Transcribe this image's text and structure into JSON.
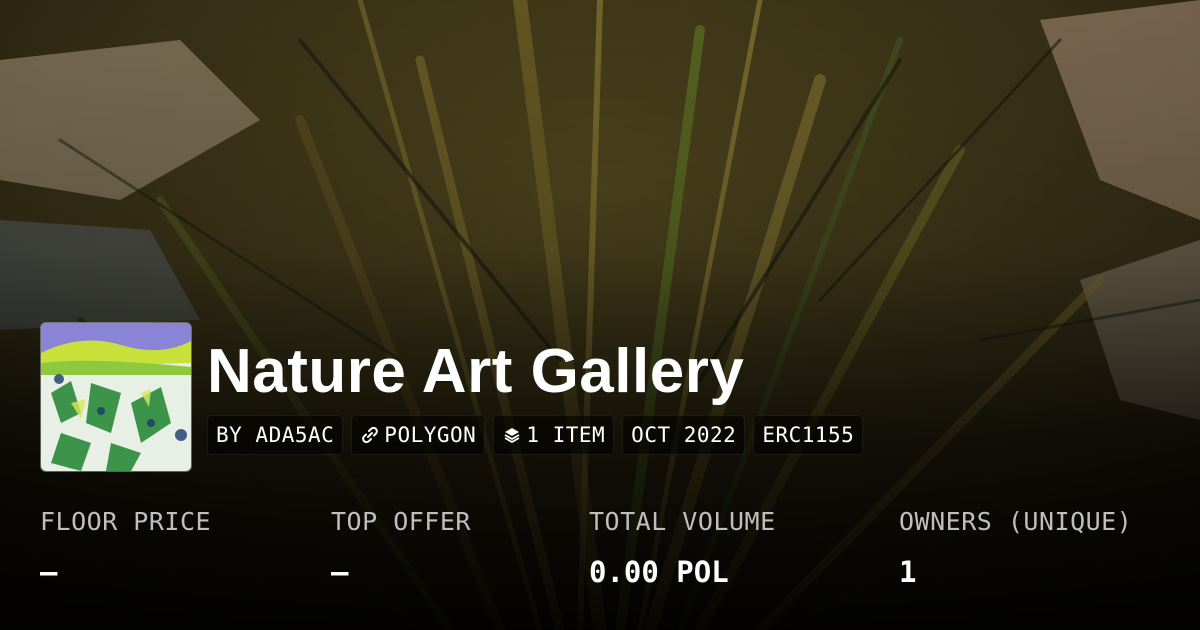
{
  "collection": {
    "title": "Nature Art Gallery",
    "badges": {
      "creator": "BY ADA5AC",
      "chain": "POLYGON",
      "items": "1 ITEM",
      "date": "OCT 2022",
      "standard": "ERC1155"
    }
  },
  "stats": [
    {
      "label": "FLOOR PRICE",
      "value": "–"
    },
    {
      "label": "TOP OFFER",
      "value": "–"
    },
    {
      "label": "TOTAL VOLUME",
      "value": "0.00 POL"
    },
    {
      "label": "OWNERS (UNIQUE)",
      "value": "1"
    }
  ],
  "icons": {
    "chain": "link-icon",
    "items": "layers-icon"
  }
}
